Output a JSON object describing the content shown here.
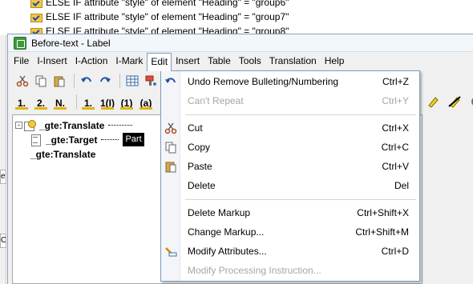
{
  "background_list": [
    "ELSE IF attribute \"style\" of element \"Heading\" = \"group6\"",
    "ELSE IF attribute \"style\" of element \"Heading\" = \"group7\"",
    "ELSE IF attribute \"style\" of element \"Heading\" = \"group8\""
  ],
  "left_tabs": [
    "ef",
    "Ca"
  ],
  "window": {
    "title": "Before-text - Label"
  },
  "menubar": {
    "items": [
      "File",
      "I-Insert",
      "I-Action",
      "I-Mark",
      "Edit",
      "Insert",
      "Table",
      "Tools",
      "Translation",
      "Help"
    ],
    "active": "Edit"
  },
  "toolbar1": {
    "icons": [
      "cut-icon",
      "copy-icon",
      "paste-icon",
      "undo-icon",
      "redo-icon",
      "table-icon",
      "paint-icon",
      "undo-icon"
    ]
  },
  "toolbar2": {
    "labels": [
      "1.",
      "2.",
      "N.",
      "1.",
      "1(I)",
      "(1)",
      "(a)"
    ]
  },
  "toolbar_right": {
    "icons": [
      "highlight-icon",
      "no-highlight-icon",
      "refresh-icon"
    ]
  },
  "tree": {
    "nodes": [
      {
        "toggle": "-",
        "icon": "translate",
        "label": "_gte:Translate"
      },
      {
        "toggle": "",
        "icon": "target",
        "label": "_gte:Target",
        "badge": "Part"
      },
      {
        "toggle": "",
        "icon": "",
        "label": "_gte:Translate"
      }
    ]
  },
  "edit_menu": {
    "items": [
      {
        "label": "Undo Remove Bulleting/Numbering",
        "shortcut": "Ctrl+Z",
        "icon": "undo-icon",
        "enabled": true
      },
      {
        "label": "Can't Repeat",
        "shortcut": "Ctrl+Y",
        "icon": "",
        "enabled": false
      },
      {
        "label": "Cut",
        "shortcut": "Ctrl+X",
        "icon": "cut-icon",
        "enabled": true
      },
      {
        "label": "Copy",
        "shortcut": "Ctrl+C",
        "icon": "copy-icon",
        "enabled": true
      },
      {
        "label": "Paste",
        "shortcut": "Ctrl+V",
        "icon": "paste-icon",
        "enabled": true
      },
      {
        "label": "Delete",
        "shortcut": "Del",
        "icon": "",
        "enabled": true
      },
      {
        "label": "Delete Markup",
        "shortcut": "Ctrl+Shift+X",
        "icon": "",
        "enabled": true
      },
      {
        "label": "Change Markup...",
        "shortcut": "Ctrl+Shift+M",
        "icon": "",
        "enabled": true
      },
      {
        "label": "Modify Attributes...",
        "shortcut": "Ctrl+D",
        "icon": "modify-attributes-icon",
        "enabled": true
      },
      {
        "label": "Modify Processing Instruction...",
        "shortcut": "",
        "icon": "",
        "enabled": false
      }
    ]
  }
}
